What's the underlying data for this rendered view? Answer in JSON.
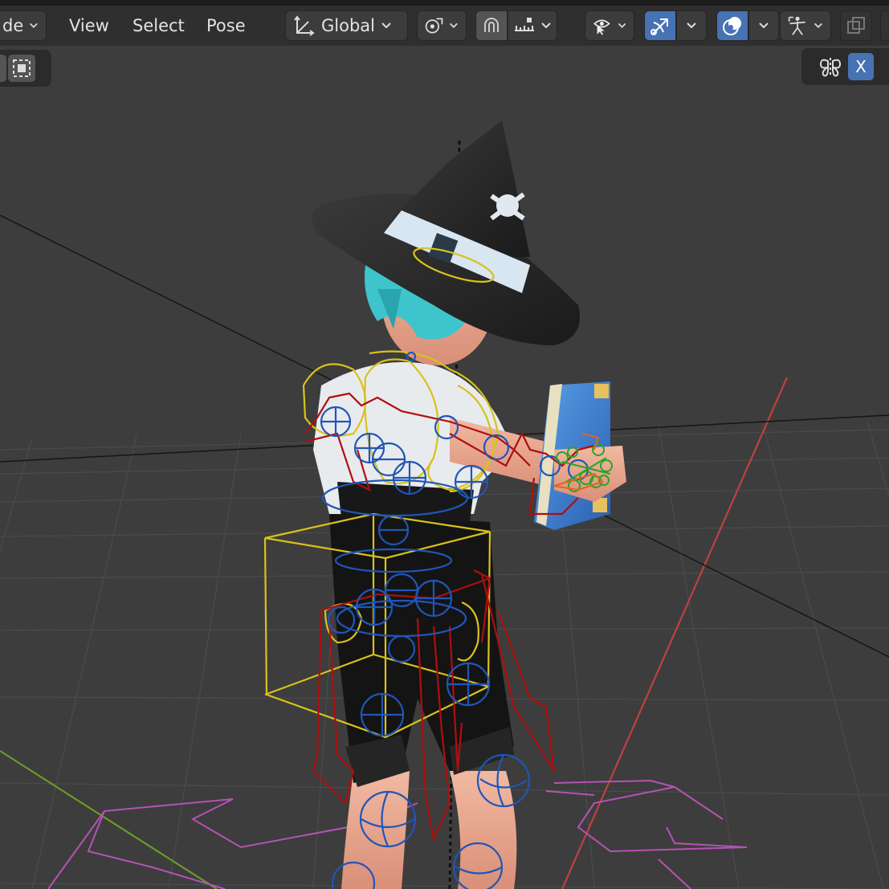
{
  "header": {
    "mode_partial": "de",
    "menus": {
      "view": "View",
      "select": "Select",
      "pose": "Pose"
    },
    "transform_orientation": "Global",
    "mirror_axis": "X"
  },
  "icons": {
    "chevron": "chevron-down-icon",
    "transform": "transform-orientation-icon",
    "pivot": "pivot-point-icon",
    "snap": "snap-magnet-icon",
    "increment": "snap-increment-icon",
    "visibility": "selectability-visibility-icon",
    "gizmo": "gizmo-icon",
    "overlay": "overlay-icon",
    "bone_overlay": "pose-bone-overlay-icon",
    "xray": "xray-toggle-icon",
    "mirror": "mirror-butterfly-icon"
  },
  "colors": {
    "header_bg": "#2f2f2f",
    "active_blue": "#4772b3",
    "viewport_bg": "#3d3d3d",
    "bone_blue": "#1f56b8",
    "bone_red": "#b00e0e",
    "bone_yellow": "#d9c21a",
    "bone_green": "#26a626",
    "root_magenta": "#b552b5"
  }
}
